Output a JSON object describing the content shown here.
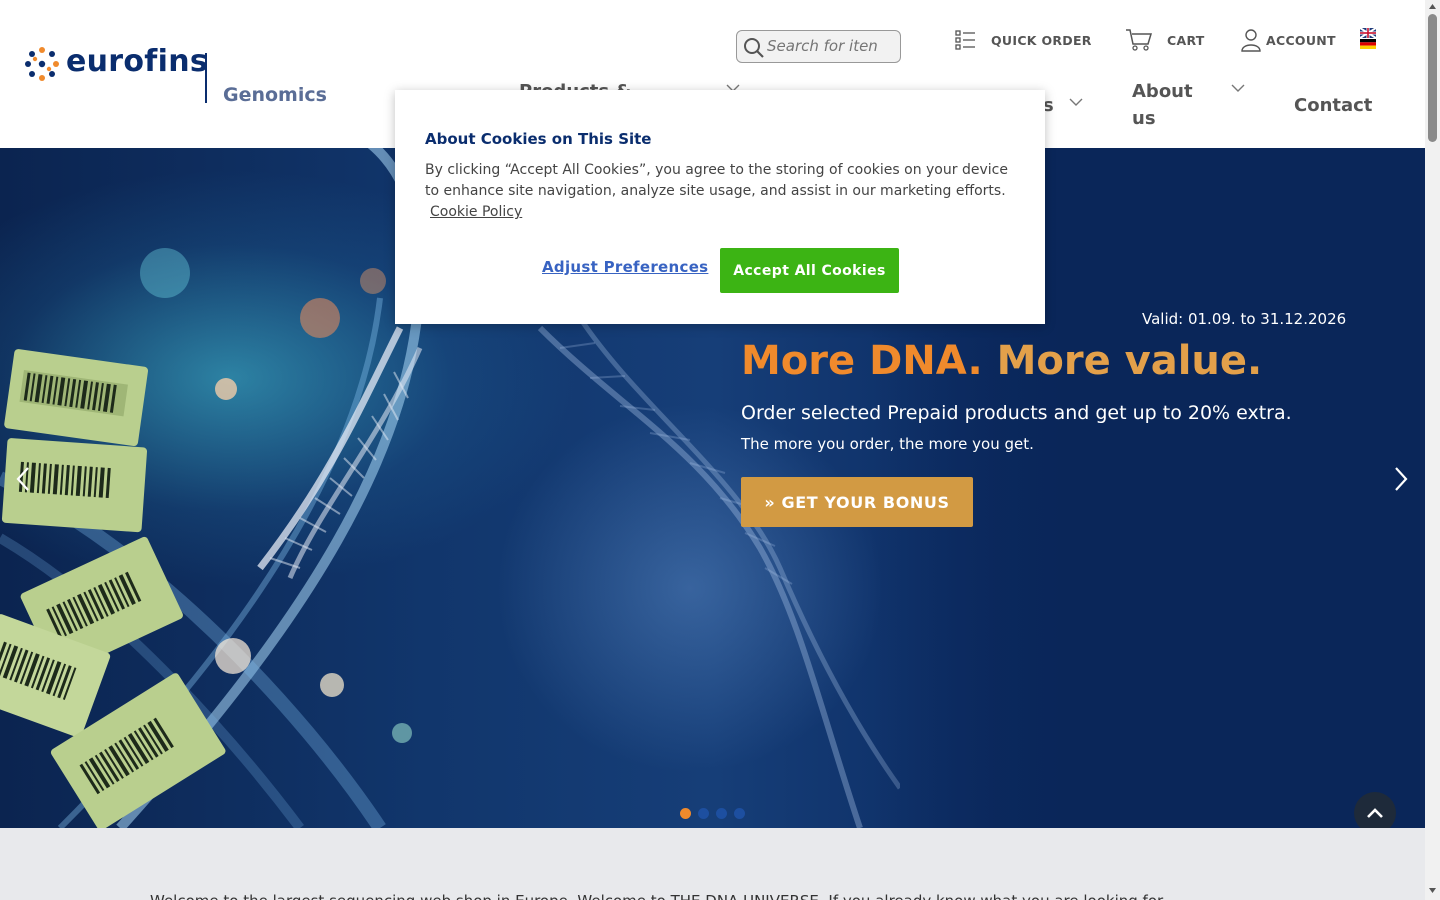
{
  "brand": {
    "name": "eurofins",
    "division": "Genomics"
  },
  "search": {
    "placeholder": "Search for iten"
  },
  "toolbar": {
    "quick_order": "QUICK ORDER",
    "cart": "CART",
    "account": "ACCOUNT",
    "language_flag": "uk-de-flag-icon"
  },
  "nav": {
    "products": "Products &",
    "services_partial": "s",
    "about_line1": "About",
    "about_line2": "us",
    "contact": "Contact"
  },
  "cookie": {
    "title": "About Cookies on This Site",
    "body": "By clicking “Accept All Cookies”, you agree to the storing of cookies on your device to enhance site navigation, analyze site usage, and assist in our marketing efforts.",
    "policy_link": "Cookie Policy",
    "adjust_label": "Adjust Preferences",
    "accept_label": "Accept All Cookies"
  },
  "hero": {
    "valid": "Valid: 01.09. to 31.12.2026",
    "title_part1": "More DNA.",
    "title_part2": "More value.",
    "subtitle": "Order selected Prepaid products and get up to 20% extra.",
    "subtitle2": "The more you order, the more you get.",
    "cta": "» GET YOUR BONUS",
    "slides": 4,
    "active_slide": 1
  },
  "welcome": {
    "text": "Welcome to the largest sequencing web shop in Europe. Welcome to THE DNA UNIVERSE. If you already know what you are looking for..."
  },
  "colors": {
    "brand_navy": "#0a2d6e",
    "accent_orange": "#f08a2c",
    "cta_gold": "#d29a43",
    "accept_green": "#3cb414",
    "link_blue": "#3863c2"
  }
}
